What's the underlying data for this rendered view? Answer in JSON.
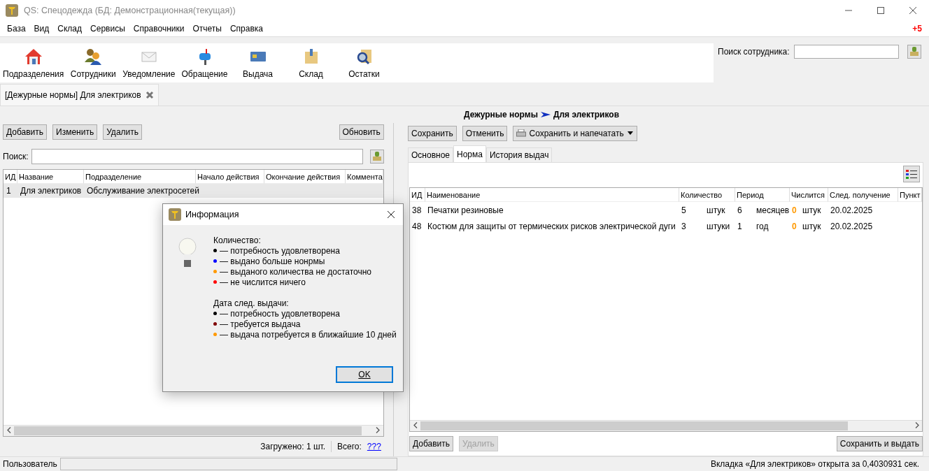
{
  "window": {
    "title": "QS: Спецодежда (БД: Демонстрационная(текущая))"
  },
  "menu": [
    "База",
    "Вид",
    "Склад",
    "Сервисы",
    "Справочники",
    "Отчеты",
    "Справка"
  ],
  "notification_count": "+5",
  "toolbar": [
    {
      "label": "Подразделения",
      "kind": "house"
    },
    {
      "label": "Сотрудники",
      "kind": "people"
    },
    {
      "label": "Уведомление",
      "kind": "envelope"
    },
    {
      "label": "Обращение",
      "kind": "mailbox"
    },
    {
      "label": "Выдача",
      "kind": "card"
    },
    {
      "label": "Склад",
      "kind": "box"
    },
    {
      "label": "Остатки",
      "kind": "magnifier"
    }
  ],
  "employee_search": {
    "label": "Поиск сотрудника:"
  },
  "doc_tabs": [
    {
      "label": "[Дежурные нормы] Для электриков",
      "selected": true
    }
  ],
  "breadcrumb": {
    "section": "Дежурные нормы",
    "item": "Для электриков"
  },
  "left": {
    "buttons": [
      "Добавить",
      "Изменить",
      "Удалить"
    ],
    "refresh_button": "Обновить",
    "search_label": "Поиск:",
    "columns": [
      "ИД",
      "Название",
      "Подразделение",
      "Начало действия",
      "Окончание действия",
      "Коммента"
    ],
    "rows": [
      {
        "cells": [
          "1",
          "Для электриков",
          "Обслуживание электросетей",
          "",
          "",
          ""
        ],
        "selected": true
      }
    ],
    "loaded": "Загружено: 1 шт.",
    "total_label": "Всего:",
    "total_link": "???"
  },
  "right": {
    "buttons": [
      "Сохранить",
      "Отменить"
    ],
    "print_button": "Сохранить и напечатать",
    "tabs": [
      {
        "label": "Основное",
        "selected": false
      },
      {
        "label": "Норма",
        "selected": true
      },
      {
        "label": "История выдач",
        "selected": false
      }
    ],
    "columns": [
      "ИД",
      "Наименование",
      "Количество",
      "Период",
      "Числится",
      "След. получение",
      "Пункт"
    ],
    "rows": [
      {
        "id": "38",
        "name": "Печатки резиновые",
        "qty": "5",
        "qty_unit": "штук",
        "period": "6",
        "period_unit": "месяцев",
        "held": "0",
        "color": "#ff9900",
        "held_unit": "штук",
        "next": "20.02.2025"
      },
      {
        "id": "48",
        "name": "Костюм для защиты от термических рисков электрической дуги",
        "qty": "3",
        "qty_unit": "штуки",
        "period": "1",
        "period_unit": "год",
        "held": "0",
        "color": "#ff9900",
        "held_unit": "штук",
        "next": "20.02.2025"
      }
    ],
    "bottom_buttons": [
      {
        "label": "Добавить",
        "disabled": false
      },
      {
        "label": "Удалить",
        "disabled": true
      }
    ],
    "save_issue_button": "Сохранить и выдать"
  },
  "status_bar": {
    "user_label": "Пользователь",
    "message": "Вкладка «Для электриков» открыта за 0,4030931 сек."
  },
  "dialog": {
    "title": "Информация",
    "sections": [
      {
        "heading": "Количество:",
        "items": [
          {
            "text": "— потребность удовлетворена",
            "color": "#000000"
          },
          {
            "text": "— выдано больше нонрмы",
            "color": "#0000ff"
          },
          {
            "text": "— выданого количества не достаточно",
            "color": "#ff9900"
          },
          {
            "text": "— не числится ничего",
            "color": "#ff0000"
          }
        ]
      },
      {
        "heading": "Дата след. выдачи:",
        "items": [
          {
            "text": "— потребность удовлетворена",
            "color": "#000000"
          },
          {
            "text": "— требуется выдача",
            "color": "#800000"
          },
          {
            "text": "— выдача потребуется в ближайшие 10 дней",
            "color": "#ff9900"
          }
        ]
      }
    ],
    "ok_button": "OK"
  }
}
